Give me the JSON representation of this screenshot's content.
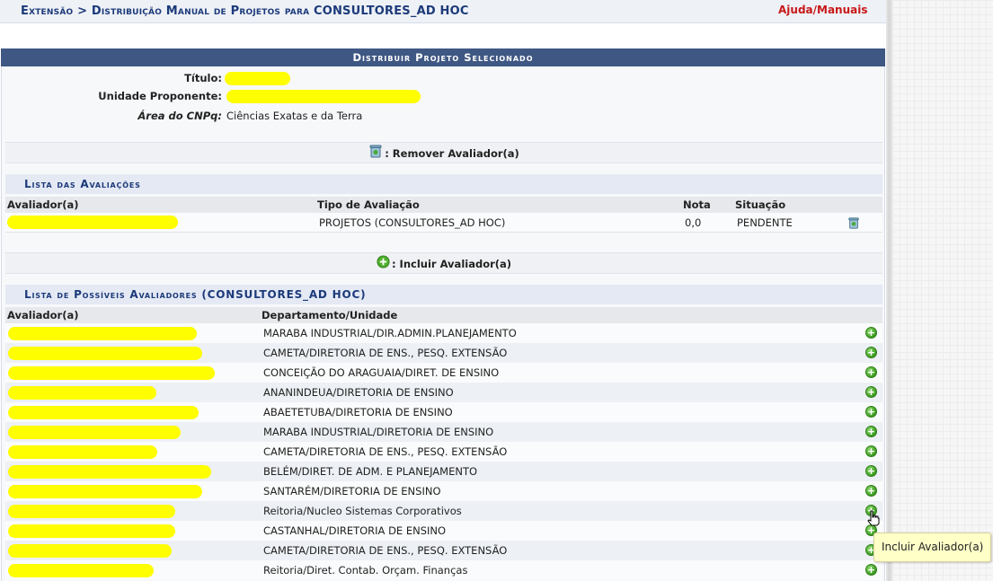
{
  "header": {
    "breadcrumb": "Extensão > Distribuição Manual de Projetos para CONSULTORES_AD HOC",
    "help_link": "Ajuda/Manuais"
  },
  "form": {
    "title": "Distribuir Projeto Selecionado",
    "fields": {
      "titulo_label": "Título:",
      "unidade_label": "Unidade Proponente:",
      "area_label": "Área do CNPq:",
      "area_value": "Ciências Exatas e da Terra"
    },
    "remove_action": ": Remover Avaliador(a)",
    "include_action": ": Incluir Avaliador(a)"
  },
  "evaluations": {
    "title": "Lista das Avaliações",
    "columns": [
      "Avaliador(a)",
      "Tipo de Avaliação",
      "Nota",
      "Situação"
    ],
    "rows": [
      {
        "tipo": "PROJETOS (CONSULTORES_AD HOC)",
        "nota": "0,0",
        "situacao": "PENDENTE"
      }
    ]
  },
  "candidates": {
    "title": "Lista de Possíveis Avaliadores (CONSULTORES_AD HOC)",
    "columns": [
      "Avaliador(a)",
      "Departamento/Unidade"
    ],
    "rows": [
      "MARABA INDUSTRIAL/DIR.ADMIN.PLANEJAMENTO",
      "CAMETA/DIRETORIA DE ENS., PESQ. EXTENSÃO",
      "CONCEIÇÃO DO ARAGUAIA/DIRET. DE ENSINO",
      "ANANINDEUA/DIRETORIA DE ENSINO",
      "ABAETETUBA/DIRETORIA DE ENSINO",
      "MARABA INDUSTRIAL/DIRETORIA DE ENSINO",
      "CAMETA/DIRETORIA DE ENS., PESQ. EXTENSÃO",
      "BELÉM/DIRET. DE ADM. E PLANEJAMENTO",
      "SANTARÉM/DIRETORIA DE ENSINO",
      "Reitoria/Nucleo Sistemas Corporativos",
      "CASTANHAL/DIRETORIA DE ENSINO",
      "CAMETA/DIRETORIA DE ENS., PESQ. EXTENSÃO",
      "Reitoria/Diret. Contab. Orçam. Finanças"
    ]
  },
  "tooltip": "Incluir Avaliador(a)",
  "icons": {
    "add": "plus-circle-icon",
    "remove": "trash-icon",
    "cursor": "hand-pointer-icon"
  },
  "colors": {
    "header_blue": "#3f5783",
    "title_blue": "#1c3a7a",
    "help_red": "#c81818",
    "redaction": "#fefe00"
  }
}
